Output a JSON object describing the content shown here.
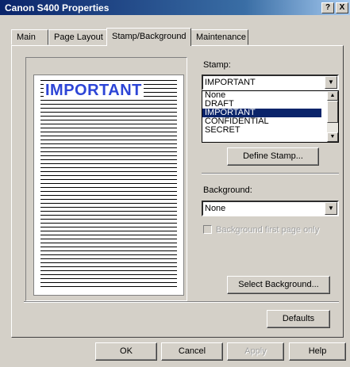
{
  "window": {
    "title": "Canon S400 Properties",
    "help_btn": "?",
    "close_btn": "X"
  },
  "tabs": [
    {
      "label": "Main"
    },
    {
      "label": "Page Layout"
    },
    {
      "label": "Stamp/Background"
    },
    {
      "label": "Maintenance"
    }
  ],
  "preview": {
    "stamp_text": "IMPORTANT"
  },
  "stamp": {
    "label": "Stamp:",
    "selected": "IMPORTANT",
    "options": [
      "None",
      "DRAFT",
      "IMPORTANT",
      "CONFIDENTIAL",
      "SECRET"
    ],
    "define_button": "Define Stamp..."
  },
  "background": {
    "label": "Background:",
    "selected": "None",
    "first_page_only": "Background first page only",
    "select_button": "Select Background..."
  },
  "defaults_button": "Defaults",
  "footer": {
    "ok": "OK",
    "cancel": "Cancel",
    "apply": "Apply",
    "help": "Help"
  },
  "colors": {
    "titlebar": "#0a246a",
    "stamp_color": "#2d45d6",
    "selection": "#0a246a"
  }
}
